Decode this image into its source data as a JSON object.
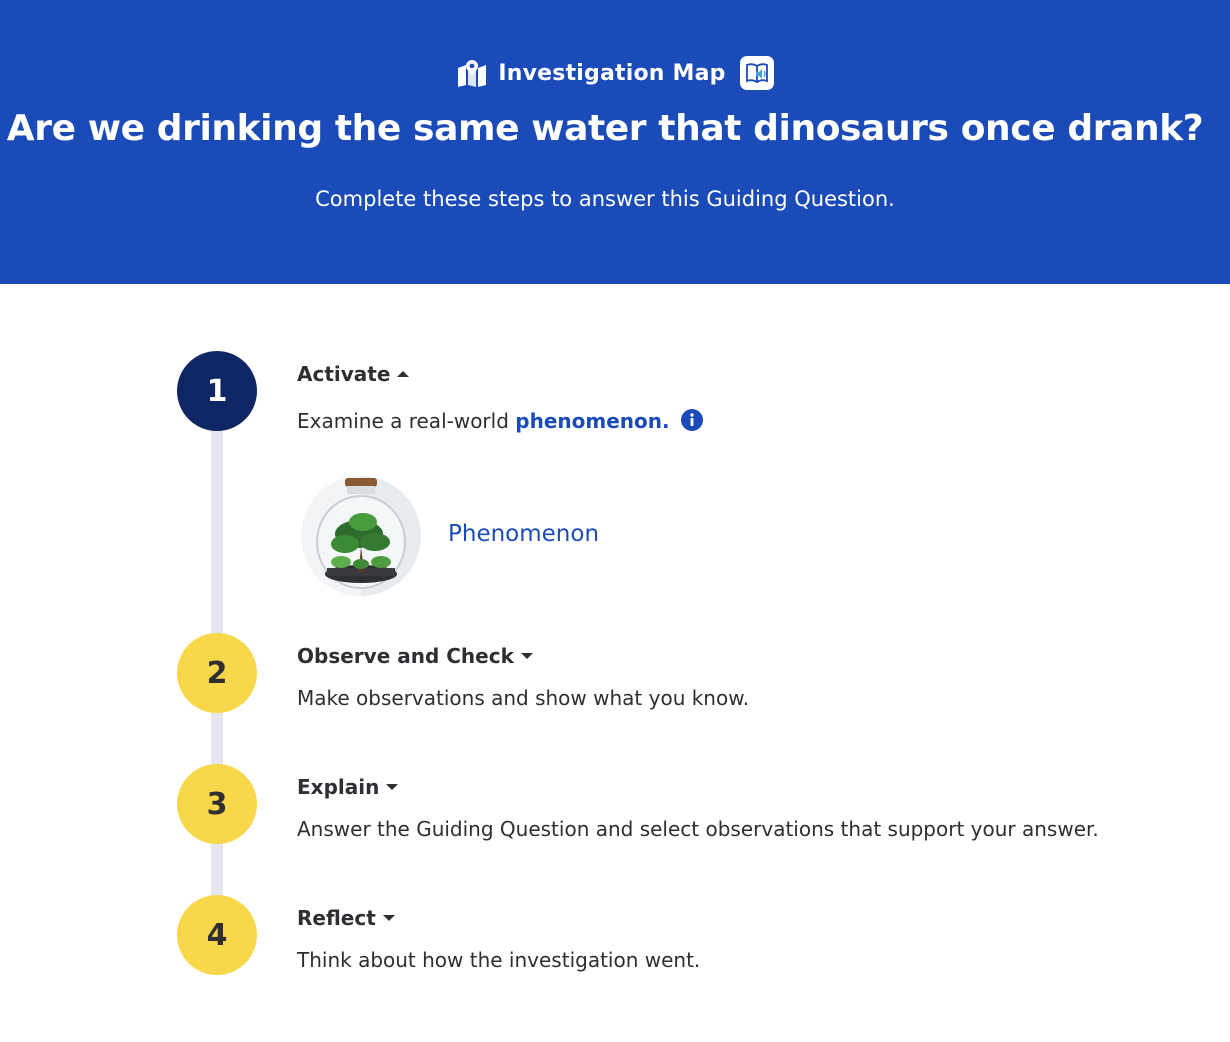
{
  "colors": {
    "brand": "#1a4bb9",
    "step_active": "#0e2663",
    "step_idle": "#f8d84a",
    "track": "#e6e6ee",
    "link": "#1a4bb9"
  },
  "header": {
    "brand_icon": "map-icon",
    "brand_title": "Investigation Map",
    "read_aloud_icon": "read-aloud-icon",
    "guiding_question": "Are we drinking the same water that dinosaurs once drank?",
    "subtitle": "Complete these steps to answer this Guiding Question."
  },
  "steps": [
    {
      "number": "1",
      "title": "Activate",
      "state": "expanded",
      "caret_icon": "caret-up-icon",
      "description_prefix": "Examine a real-world ",
      "description_term": "phenomenon.",
      "info_icon": "info-icon",
      "resource": {
        "thumbnail": "terrarium-image",
        "label": "Phenomenon"
      }
    },
    {
      "number": "2",
      "title": "Observe and Check",
      "state": "collapsed",
      "caret_icon": "caret-down-icon",
      "description": "Make observations and show what you know."
    },
    {
      "number": "3",
      "title": "Explain",
      "state": "collapsed",
      "caret_icon": "caret-down-icon",
      "description": "Answer the Guiding Question and select observations that support your answer."
    },
    {
      "number": "4",
      "title": "Reflect",
      "state": "collapsed",
      "caret_icon": "caret-down-icon",
      "description": "Think about how the investigation went."
    }
  ]
}
